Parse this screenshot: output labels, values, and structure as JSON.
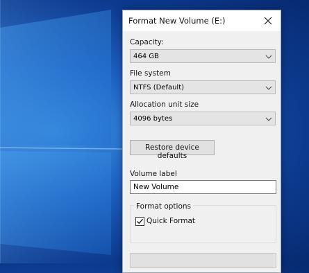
{
  "dialog": {
    "title": "Format New Volume (E:)",
    "close_icon": "close-icon"
  },
  "capacity": {
    "label": "Capacity:",
    "value": "464 GB"
  },
  "file_system": {
    "label": "File system",
    "value": "NTFS (Default)"
  },
  "allocation": {
    "label": "Allocation unit size",
    "value": "4096 bytes"
  },
  "restore_button": {
    "label": "Restore device defaults"
  },
  "volume_label": {
    "label": "Volume label",
    "value": "New Volume"
  },
  "format_options": {
    "legend": "Format options",
    "quick_format": {
      "label": "Quick Format",
      "checked": true
    }
  },
  "icons": {
    "chevron": "chevron-down-icon",
    "check": "checkmark-icon"
  }
}
